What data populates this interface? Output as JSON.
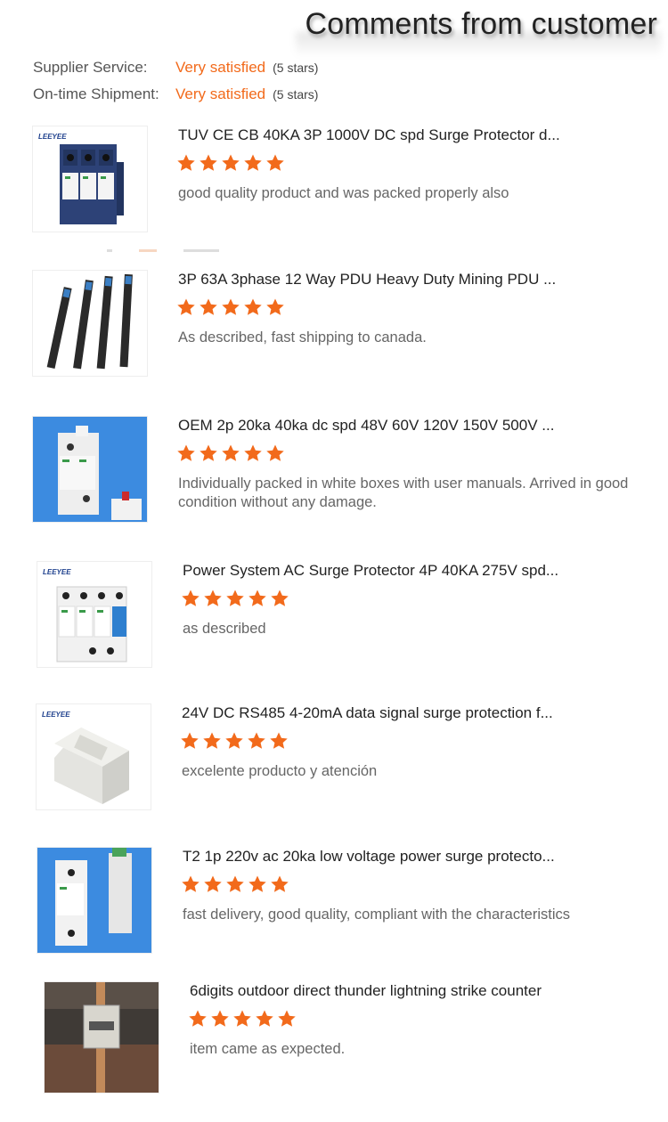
{
  "header": {
    "title": "Comments from customer"
  },
  "ratings": [
    {
      "label": "Supplier Service:",
      "value": "Very satisfied",
      "stars": "(5 stars)"
    },
    {
      "label": "On-time Shipment:",
      "value": "Very satisfied",
      "stars": "(5 stars)"
    }
  ],
  "colors": {
    "accent": "#f26a1b",
    "star": "#f26a1b"
  },
  "reviews": [
    {
      "title": "TUV CE CB 40KA 3P 1000V DC spd Surge Protector d...",
      "rating": 5,
      "comment": "good quality product and was packed properly also",
      "icon": "surge-protector-3p-image",
      "brand": "LEEYEE"
    },
    {
      "title": "3P 63A 3phase 12 Way PDU Heavy Duty Mining PDU ...",
      "rating": 5,
      "comment": "As described, fast shipping to canada.",
      "icon": "pdu-strips-image"
    },
    {
      "title": "OEM 2p 20ka 40ka dc spd 48V 60V 120V 150V 500V ...",
      "rating": 5,
      "comment": "Individually packed in white boxes with user manuals. Arrived in good condition without any damage.",
      "icon": "surge-protector-2p-image"
    },
    {
      "title": "Power System AC Surge Protector 4P 40KA 275V spd...",
      "rating": 5,
      "comment": "as described",
      "icon": "surge-protector-4p-image",
      "brand": "LEEYEE"
    },
    {
      "title": "24V DC RS485 4-20mA data signal surge protection f...",
      "rating": 5,
      "comment": "excelente producto y atención",
      "icon": "signal-surge-protector-image",
      "brand": "LEEYEE"
    },
    {
      "title": "T2 1p 220v ac 20ka low voltage power surge protecto...",
      "rating": 5,
      "comment": "fast delivery, good quality, compliant with the characteristics",
      "icon": "surge-protector-1p-image"
    },
    {
      "title": "6digits outdoor direct thunder lightning strike counter",
      "rating": 5,
      "comment": "item came as expected.",
      "icon": "lightning-counter-image"
    }
  ]
}
